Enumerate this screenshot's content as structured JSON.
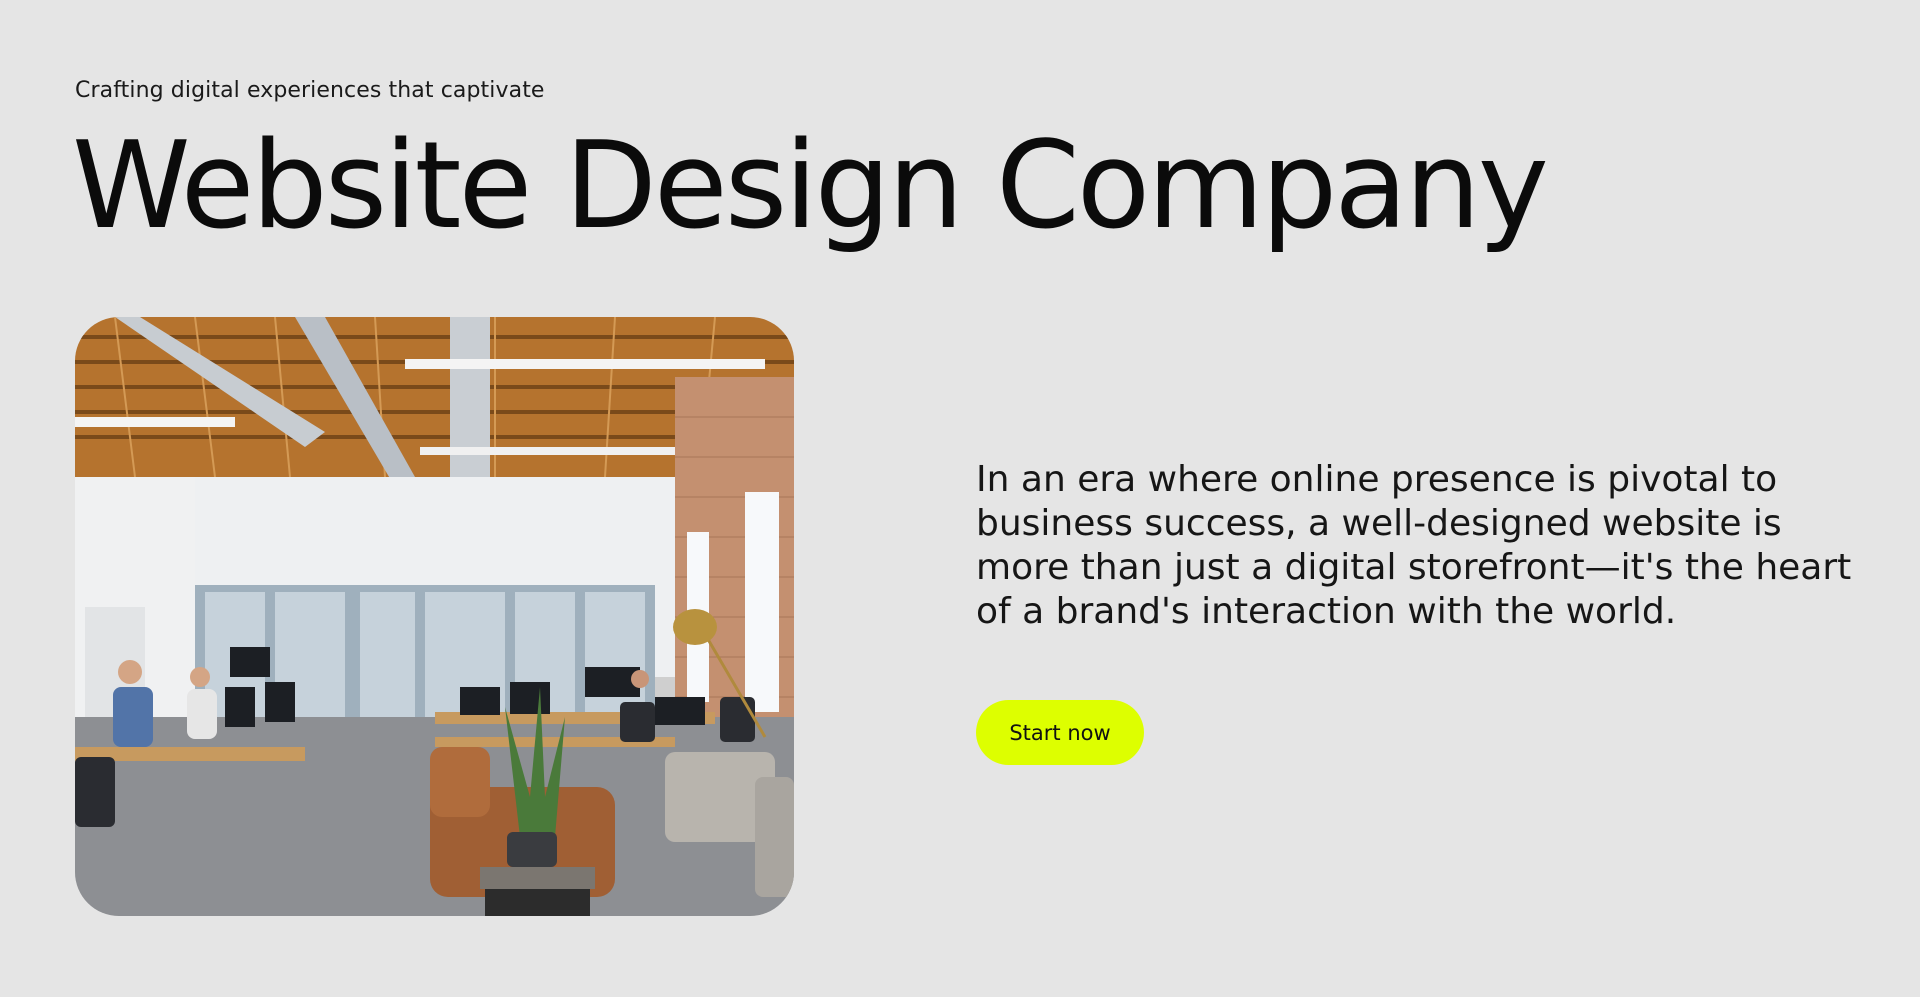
{
  "hero": {
    "eyebrow": "Crafting digital experiences that captivate",
    "title": "Website Design Company",
    "description": "In an era where online presence is pivotal to business success, a well-designed website is more than just a digital storefront—it's the heart of a brand's interaction with the world.",
    "cta_label": "Start now"
  },
  "colors": {
    "background": "#e5e5e5",
    "accent": "#ddff00",
    "text": "#0b0b0b"
  }
}
